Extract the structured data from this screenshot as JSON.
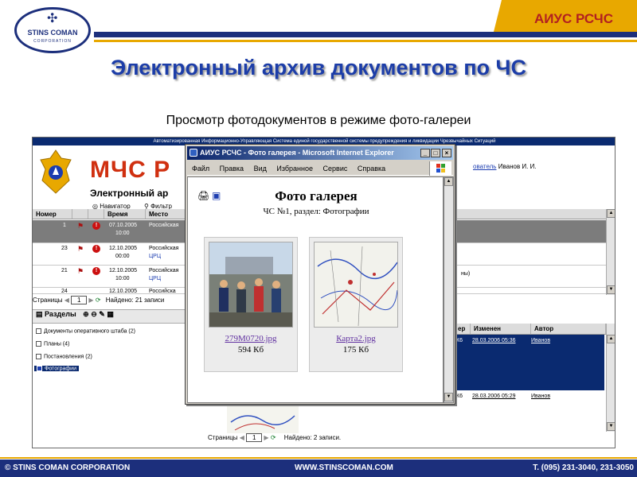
{
  "slide": {
    "brand": "АИУС РСЧС",
    "title": "Электронный архив документов по ЧС",
    "subtitle": "Просмотр фотодокументов в режиме фото-галереи",
    "logo_main": "STINS COMAN",
    "logo_sub": "CORPORATION",
    "footer_left": "© STINS COMAN CORPORATION",
    "footer_center": "WWW.STINSCOMAN.COM",
    "footer_right": "Т. (095) 231-3040, 231-3050"
  },
  "app": {
    "header_text": "Автоматизированная Информационно-Управляющая Система единой государственной системы предупреждения и ликвидации Чрезвычайных Ситуаций",
    "org_name": "МЧС Р",
    "module_title": "Электронный ар",
    "user_label": "ователь",
    "user_name": "Иванов И. И.",
    "toolbar": {
      "navigator": "Навигатор",
      "filter": "Фильтр"
    },
    "grid1": {
      "columns": [
        "Номер",
        "Время",
        "Место"
      ],
      "rows": [
        {
          "num": "1",
          "date": "07.10.2005",
          "time": "10:00",
          "place": "Российская",
          "selected": true
        },
        {
          "num": "23",
          "date": "12.10.2005",
          "time": "00:00",
          "place": "Российская",
          "place2": "ЦРЦ",
          "selected": false
        },
        {
          "num": "21",
          "date": "12.10.2005",
          "time": "10:00",
          "place": "Российская",
          "place2": "ЦРЦ",
          "extra": "ны)",
          "selected": false
        },
        {
          "num": "24",
          "date": "12.10.2005",
          "time": "",
          "place": "Российска",
          "selected": false
        }
      ]
    },
    "pager1": {
      "label": "Страницы",
      "page": "1",
      "found": "Найдено: 21 записи"
    },
    "sections": {
      "title": "Разделы",
      "items": [
        "Документы оперативного штаба (2)",
        "Планы (4)",
        "Постановления (2)",
        "Фотографии"
      ]
    },
    "grid2": {
      "columns": [
        "ер",
        "Изменен",
        "Автор"
      ],
      "rows": [
        {
          "ver": "К6",
          "changed": "28.03.2006 05:36",
          "author": "Иванов"
        },
        {
          "ver": "К6",
          "changed": "28.03.2006 05:29",
          "author": "Иванов"
        }
      ]
    },
    "pager2": {
      "label": "Страницы",
      "page": "1",
      "found": "Найдено: 2 записи."
    }
  },
  "ie_window": {
    "title": "АИУС РСЧС - Фото галерея - Microsoft Internet Explorer",
    "menu": [
      "Файл",
      "Правка",
      "Вид",
      "Избранное",
      "Сервис",
      "Справка"
    ],
    "gallery_title": "Фото галерея",
    "gallery_subtitle": "ЧС №1, раздел: Фотографии",
    "photos": [
      {
        "filename": "279M0720.jpg",
        "size": "594 Кб"
      },
      {
        "filename": "Карта2.jpg",
        "size": "175 Кб"
      }
    ]
  },
  "colors": {
    "navy": "#1c2f7c",
    "gold": "#e8a800",
    "title_blue": "#1c3da8",
    "brand_red": "#b22020",
    "mchs_red": "#d03010"
  }
}
